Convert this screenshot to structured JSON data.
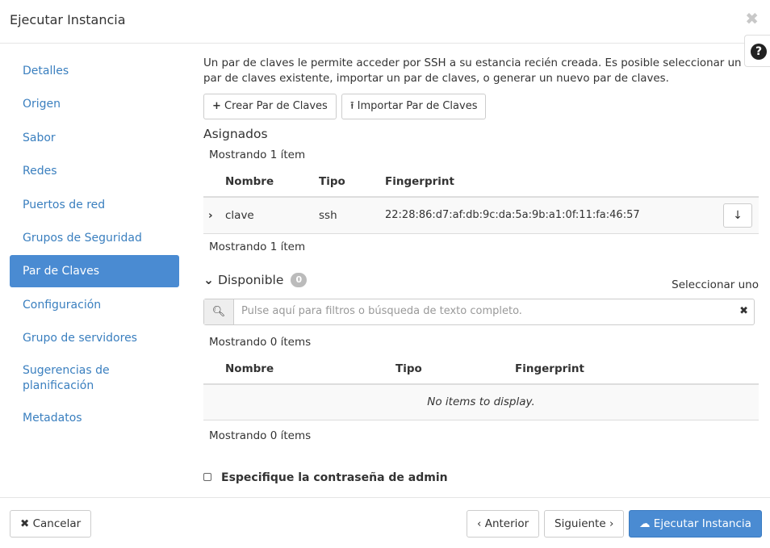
{
  "modal": {
    "title": "Ejecutar Instancia",
    "close_glyph": "✖",
    "help_glyph": "?"
  },
  "sidebar": {
    "items": [
      {
        "label": "Detalles"
      },
      {
        "label": "Origen"
      },
      {
        "label": "Sabor"
      },
      {
        "label": "Redes"
      },
      {
        "label": "Puertos de red"
      },
      {
        "label": "Grupos de Seguridad"
      },
      {
        "label": "Par de Claves",
        "active": true
      },
      {
        "label": "Configuración"
      },
      {
        "label": "Grupo de servidores"
      },
      {
        "label": "Sugerencias de planificación"
      },
      {
        "label": "Metadatos"
      }
    ]
  },
  "main": {
    "description": "Un par de claves le permite acceder por SSH a su estancia recién creada. Es posible seleccionar un par de claves existente, importar un par de claves, o generar un nuevo par de claves.",
    "create_button": "Crear Par de Claves",
    "import_button": "Importar Par de Claves",
    "assigned": {
      "title": "Asignados",
      "count_top": "Mostrando 1 ítem",
      "count_bottom": "Mostrando 1 ítem",
      "headers": {
        "name": "Nombre",
        "type": "Tipo",
        "fingerprint": "Fingerprint"
      },
      "rows": [
        {
          "name": "clave",
          "type": "ssh",
          "fingerprint": "22:28:86:d7:af:db:9c:da:5a:9b:a1:0f:11:fa:46:57"
        }
      ]
    },
    "available": {
      "title": "Disponible",
      "badge": "0",
      "select_one": "Seleccionar uno",
      "search_placeholder": "Pulse aquí para filtros o búsqueda de texto completo.",
      "count_top": "Mostrando 0 ítems",
      "count_bottom": "Mostrando 0 ítems",
      "headers": {
        "name": "Nombre",
        "type": "Tipo",
        "fingerprint": "Fingerprint"
      },
      "empty_text": "No items to display."
    },
    "admin_password_label": "Especifique la contraseña de admin"
  },
  "footer": {
    "cancel": "Cancelar",
    "previous": "Anterior",
    "next": "Siguiente",
    "launch": "Ejecutar Instancia"
  }
}
